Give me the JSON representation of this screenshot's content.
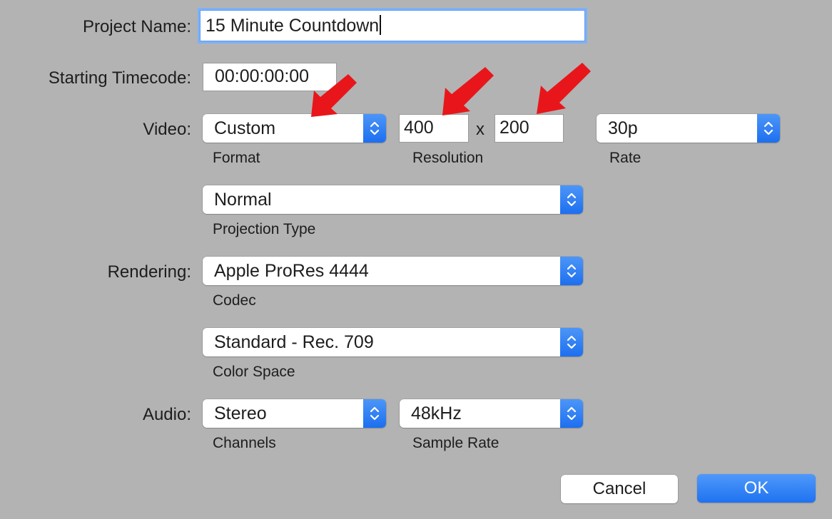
{
  "project_name": {
    "label": "Project Name:",
    "value": "15 Minute Countdown"
  },
  "starting_timecode": {
    "label": "Starting Timecode:",
    "value": "00:00:00:00"
  },
  "video": {
    "label": "Video:",
    "format": {
      "value": "Custom",
      "caption": "Format"
    },
    "resolution": {
      "width": "400",
      "separator": "x",
      "height": "200",
      "caption": "Resolution"
    },
    "rate": {
      "value": "30p",
      "caption": "Rate"
    },
    "projection": {
      "value": "Normal",
      "caption": "Projection Type"
    }
  },
  "rendering": {
    "label": "Rendering:",
    "codec": {
      "value": "Apple ProRes 4444",
      "caption": "Codec"
    },
    "color_space": {
      "value": "Standard - Rec. 709",
      "caption": "Color Space"
    }
  },
  "audio": {
    "label": "Audio:",
    "channels": {
      "value": "Stereo",
      "caption": "Channels"
    },
    "sample_rate": {
      "value": "48kHz",
      "caption": "Sample Rate"
    }
  },
  "buttons": {
    "cancel": "Cancel",
    "ok": "OK"
  },
  "colors": {
    "background": "#b3b3b3",
    "accent": "#1f72f1",
    "focus_ring": "#7eb1f6",
    "annotation_arrow": "#e8161a"
  },
  "icons": {
    "popup_stepper": "chevron-up-down-icon",
    "annotation": "red-arrow-annotation"
  }
}
